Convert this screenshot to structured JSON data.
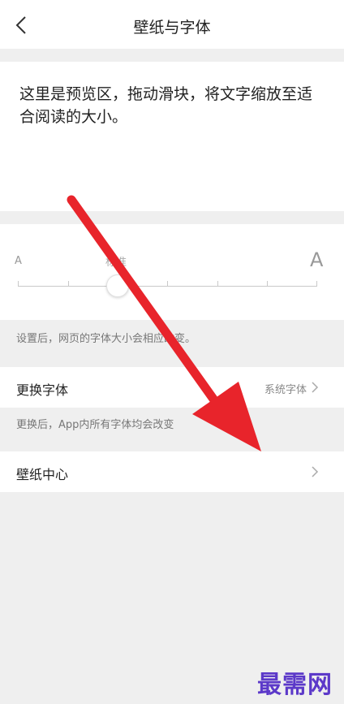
{
  "header": {
    "title": "壁纸与字体",
    "back_icon": "chevron-left-icon"
  },
  "preview": {
    "text": "这里是预览区，拖动滑块，将文字缩放至适合阅读的大小。"
  },
  "slider": {
    "small_label": "A",
    "standard_label": "标准",
    "large_label": "A",
    "level": 0.33,
    "note": "设置后，网页的字体大小会相应改变。"
  },
  "font_row": {
    "label": "更换字体",
    "value": "系统字体",
    "note": "更换后，App内所有字体均会改变"
  },
  "wallpaper_row": {
    "label": "壁纸中心"
  },
  "annotation_arrow_color": "#e8242b",
  "watermark": {
    "text": "最需网",
    "color": "#5c39c9"
  }
}
